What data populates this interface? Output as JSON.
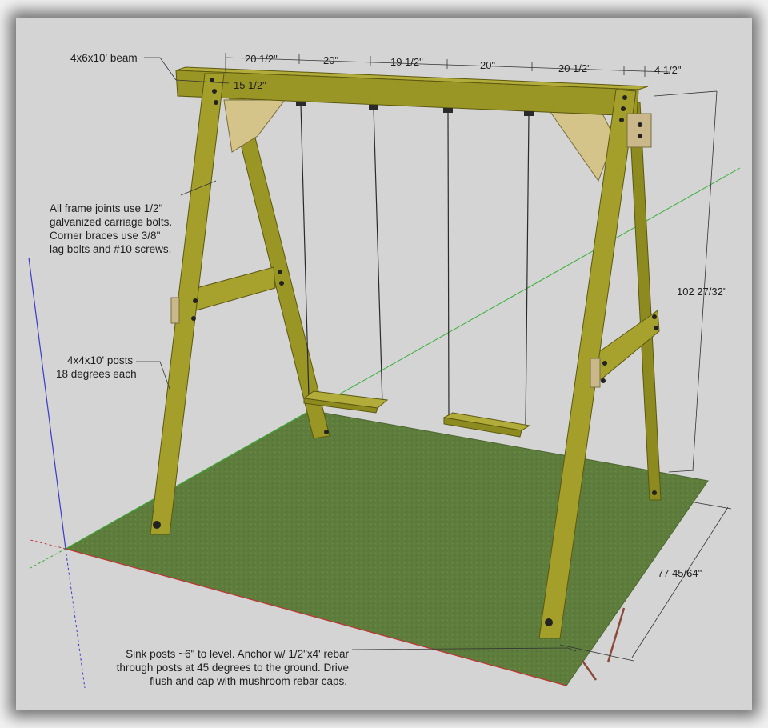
{
  "labels": {
    "beam": "4x6x10' beam",
    "posts_line1": "4x4x10' posts",
    "posts_line2": "18 degrees each",
    "joints_line1": "All frame joints use 1/2\"",
    "joints_line2": "galvanized carriage bolts.",
    "joints_line3": "Corner braces use 3/8\"",
    "joints_line4": "lag bolts and #10 screws.",
    "sink_line1": "Sink posts ~6\" to level. Anchor w/ 1/2\"x4' rebar",
    "sink_line2": "through posts at 45 degrees to the ground. Drive",
    "sink_line3": "flush and cap with mushroom rebar caps."
  },
  "dimensions": {
    "top_1": "20 1/2\"",
    "top_2": "20\"",
    "top_3": "19 1/2\"",
    "top_4": "20\"",
    "top_5": "20 1/2\"",
    "top_6": "4 1/2\"",
    "end_offset": "15 1/2\"",
    "height": "102 27/32\"",
    "depth": "77 45/64\""
  },
  "colors": {
    "wood": "#9a9626",
    "wood_light": "#b2ad3a",
    "wood_dark": "#6e6a14",
    "brace": "#d4c48a",
    "ground": "#5e7d3c",
    "canvas": "#d4d4d4",
    "axis_red": "#c23434",
    "axis_green": "#37b037",
    "axis_blue": "#3a3acc"
  }
}
